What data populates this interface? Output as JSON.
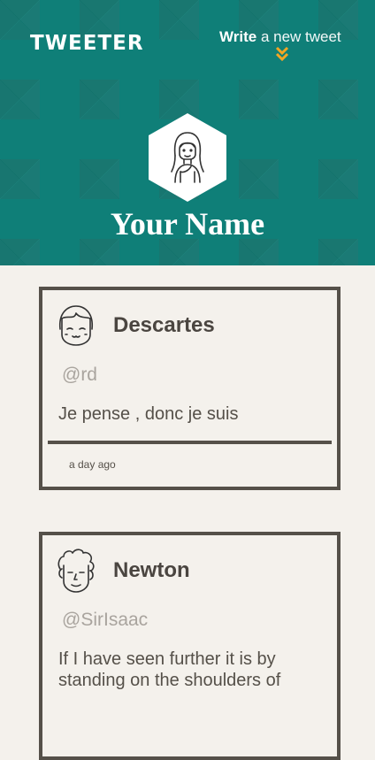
{
  "header": {
    "logo": "TWEETER",
    "write_strong": "Write",
    "write_rest": "a new tweet",
    "user_name": "Your Name"
  },
  "tweets": [
    {
      "name": "Descartes",
      "handle": "@rd",
      "text": "Je pense , donc je suis",
      "time": "a day ago"
    },
    {
      "name": "Newton",
      "handle": "@SirIsaac",
      "text": "If I have seen further it is by standing on the shoulders of",
      "time": ""
    }
  ],
  "colors": {
    "header_teal": "#0f7f78",
    "accent_orange": "#f5a623",
    "card_border": "#555049",
    "page_bg": "#f4f1ec"
  },
  "icons": {
    "write_arrow": "double-chevron-down-icon"
  }
}
